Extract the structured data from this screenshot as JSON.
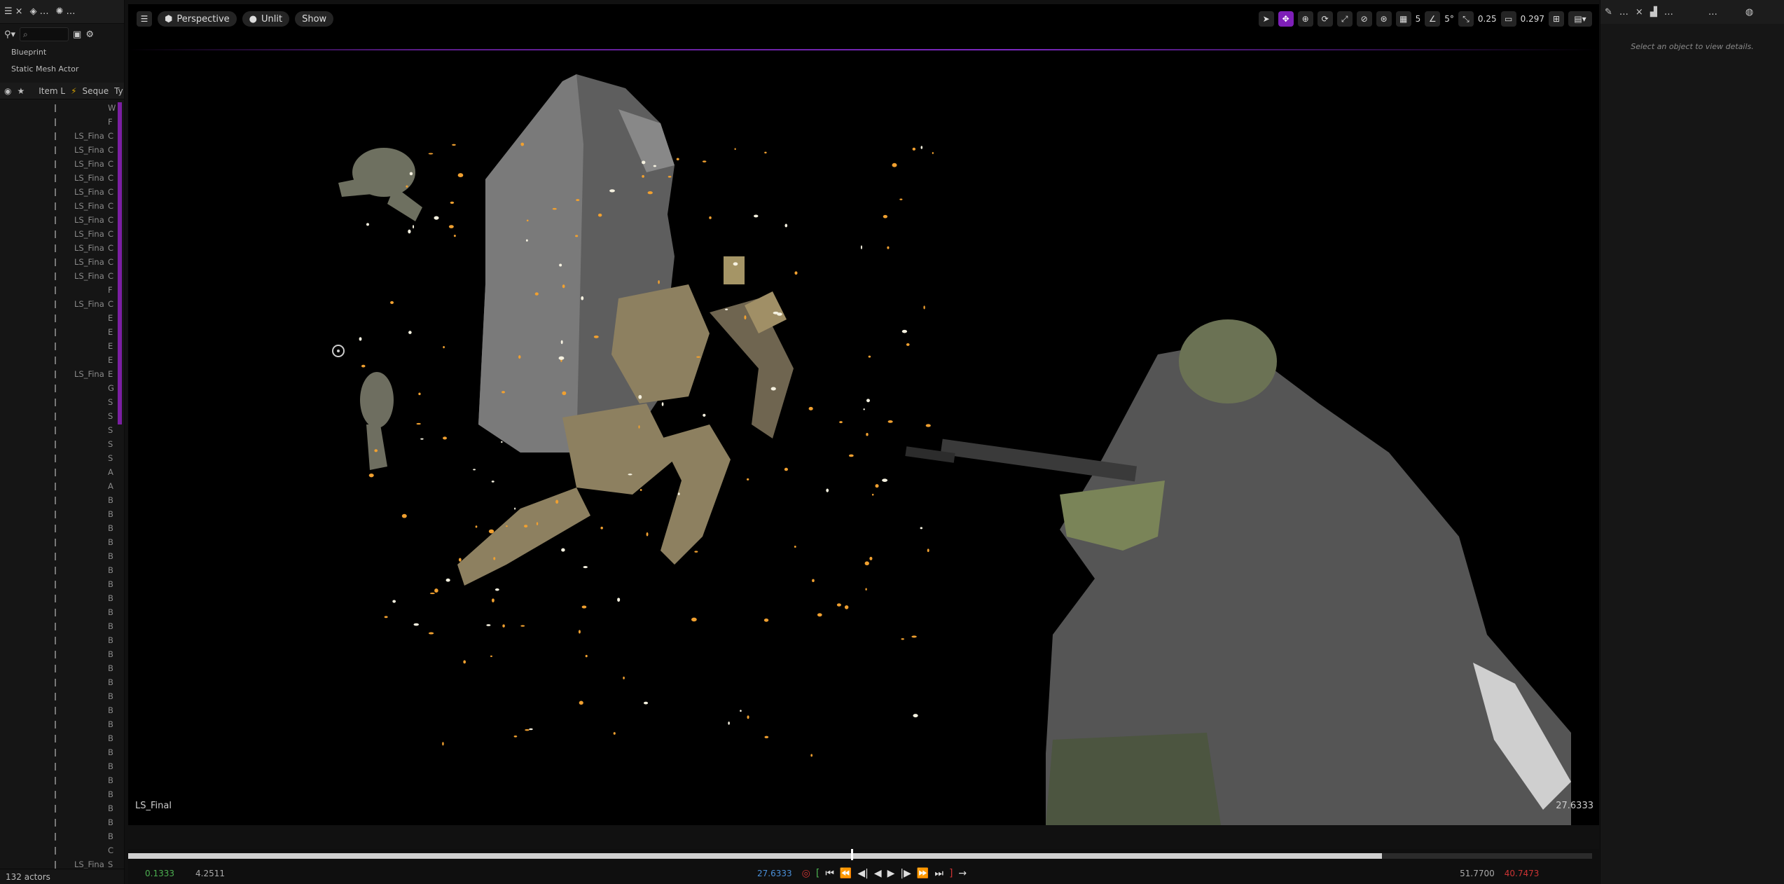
{
  "outliner": {
    "tab_close": "×",
    "menu": "…",
    "type_blueprint": "Blueprint",
    "type_static_mesh": "Static Mesh Actor",
    "header": {
      "col_item": "Item L",
      "col_seq": "Seque",
      "col_type": "Ty"
    },
    "rows": [
      {
        "lbl": "",
        "ch": "W"
      },
      {
        "lbl": "",
        "ch": "F"
      },
      {
        "lbl": "LS_Fina",
        "ch": "C"
      },
      {
        "lbl": "LS_Fina",
        "ch": "C"
      },
      {
        "lbl": "LS_Fina",
        "ch": "C"
      },
      {
        "lbl": "LS_Fina",
        "ch": "C"
      },
      {
        "lbl": "LS_Fina",
        "ch": "C"
      },
      {
        "lbl": "LS_Fina",
        "ch": "C"
      },
      {
        "lbl": "LS_Fina",
        "ch": "C"
      },
      {
        "lbl": "LS_Fina",
        "ch": "C"
      },
      {
        "lbl": "LS_Fina",
        "ch": "C"
      },
      {
        "lbl": "LS_Fina",
        "ch": "C"
      },
      {
        "lbl": "LS_Fina",
        "ch": "C"
      },
      {
        "lbl": "",
        "ch": "F"
      },
      {
        "lbl": "LS_Fina",
        "ch": "C"
      },
      {
        "lbl": "",
        "ch": "E"
      },
      {
        "lbl": "",
        "ch": "E"
      },
      {
        "lbl": "",
        "ch": "E"
      },
      {
        "lbl": "",
        "ch": "E"
      },
      {
        "lbl": "LS_Fina",
        "ch": "E"
      },
      {
        "lbl": "",
        "ch": "G"
      },
      {
        "lbl": "",
        "ch": "S"
      },
      {
        "lbl": "",
        "ch": "S"
      },
      {
        "lbl": "",
        "ch": "S"
      },
      {
        "lbl": "",
        "ch": "S"
      },
      {
        "lbl": "",
        "ch": "S"
      },
      {
        "lbl": "",
        "ch": "A"
      },
      {
        "lbl": "",
        "ch": "A"
      },
      {
        "lbl": "",
        "ch": "B"
      },
      {
        "lbl": "",
        "ch": "B"
      },
      {
        "lbl": "",
        "ch": "B"
      },
      {
        "lbl": "",
        "ch": "B"
      },
      {
        "lbl": "",
        "ch": "B"
      },
      {
        "lbl": "",
        "ch": "B"
      },
      {
        "lbl": "",
        "ch": "B"
      },
      {
        "lbl": "",
        "ch": "B"
      },
      {
        "lbl": "",
        "ch": "B"
      },
      {
        "lbl": "",
        "ch": "B"
      },
      {
        "lbl": "",
        "ch": "B"
      },
      {
        "lbl": "",
        "ch": "B"
      },
      {
        "lbl": "",
        "ch": "B"
      },
      {
        "lbl": "",
        "ch": "B"
      },
      {
        "lbl": "",
        "ch": "B"
      },
      {
        "lbl": "",
        "ch": "B"
      },
      {
        "lbl": "",
        "ch": "B"
      },
      {
        "lbl": "",
        "ch": "B"
      },
      {
        "lbl": "",
        "ch": "B"
      },
      {
        "lbl": "",
        "ch": "B"
      },
      {
        "lbl": "",
        "ch": "B"
      },
      {
        "lbl": "",
        "ch": "B"
      },
      {
        "lbl": "",
        "ch": "B"
      },
      {
        "lbl": "",
        "ch": "B"
      },
      {
        "lbl": "",
        "ch": "B"
      },
      {
        "lbl": "",
        "ch": "C"
      },
      {
        "lbl": "LS_Fina",
        "ch": "S"
      }
    ],
    "footer": "132 actors"
  },
  "viewport": {
    "perspective": "Perspective",
    "unlit": "Unlit",
    "show": "Show",
    "grid_snap": "5",
    "rot_snap": "5°",
    "scale_snap": "0.25",
    "cam_speed": "0.297",
    "sequence_label": "LS_Final",
    "time": "27.6333"
  },
  "timeline": {
    "start": "0.1333",
    "duration": "4.2511",
    "current": "27.6333",
    "end": "51.7700",
    "end_red": "40.7473"
  },
  "details": {
    "tab_menu": "…",
    "empty_msg": "Select an object to view details."
  },
  "colors": {
    "accent": "#7e1fb8",
    "bg": "#000000",
    "panel": "#151515"
  }
}
